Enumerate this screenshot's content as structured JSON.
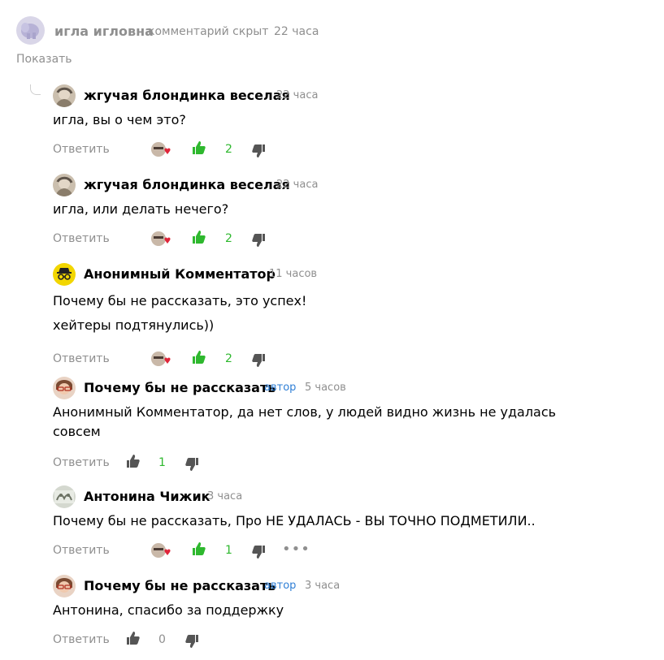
{
  "hidden": {
    "name": "игла игловна",
    "note": "комментарий скрыт",
    "time": "22 часа",
    "show": "Показать"
  },
  "reply_label": "Ответить",
  "author_badge": "автор",
  "comments": [
    {
      "name": "жгучая блондинка веселая",
      "time": "22 часа",
      "lines": [
        "игла, вы о чем это?"
      ],
      "likes": "2"
    },
    {
      "name": "жгучая блондинка веселая",
      "time": "22 часа",
      "lines": [
        "игла, или делать нечего?"
      ],
      "likes": "2"
    },
    {
      "name": "Анонимный Комментатор",
      "time": "11 часов",
      "lines": [
        "Почему бы не рассказать, это успех!",
        "хейтеры подтянулись))"
      ],
      "likes": "2"
    },
    {
      "name": "Почему бы не рассказать",
      "time": "5 часов",
      "lines": [
        "Анонимный Комментатор, да нет слов, у людей видно жизнь не удалась",
        "совсем"
      ],
      "likes": "1"
    },
    {
      "name": "Антонина Чижик",
      "time": "3 часа",
      "lines": [
        "Почему бы не рассказать, Про НЕ УДАЛАСЬ - ВЫ ТОЧНО ПОДМЕТИЛИ.."
      ],
      "likes": "1"
    },
    {
      "name": "Почему бы не рассказать",
      "time": "3 часа",
      "lines": [
        "Антонина, спасибо за поддержку"
      ],
      "likes": "0"
    }
  ],
  "colors": {
    "like_active": "#2eb82e",
    "muted": "#8f8f8f",
    "author": "#2f7fd6",
    "dislike": "#555555"
  }
}
